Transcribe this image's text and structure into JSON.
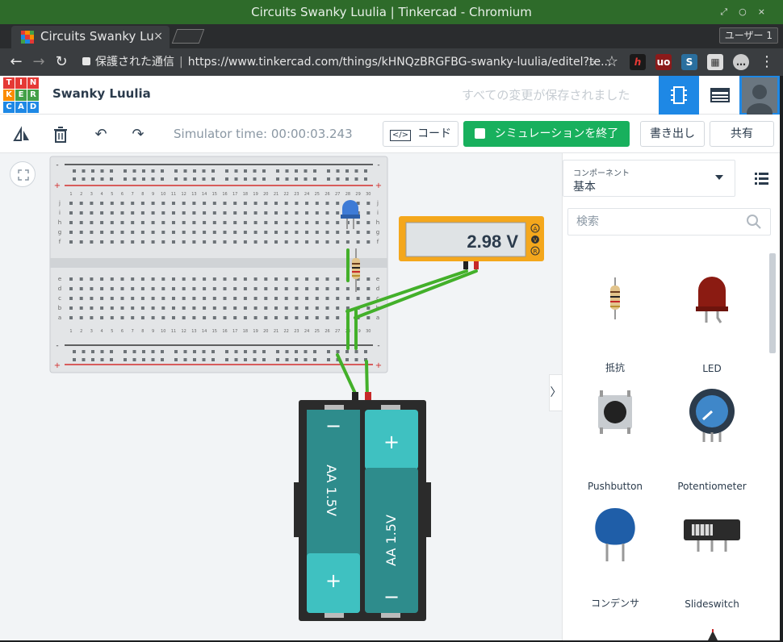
{
  "window": {
    "title": "Circuits Swanky Luulia | Tinkercad - Chromium"
  },
  "browser": {
    "tab_title": "Circuits Swanky Lu",
    "tab_close": "×",
    "user_label": "ユーザー 1",
    "secure_label": "保護された通信",
    "url": "https://www.tinkercad.com/things/kHNQzBRGFBG-swanky-luulia/editel?te...",
    "ext_h": "h",
    "ext_ub_count": "2",
    "ext_s": "S"
  },
  "app": {
    "logo_letters": [
      "T",
      "I",
      "N",
      "K",
      "E",
      "R",
      "C",
      "A",
      "D"
    ],
    "project_name": "Swanky Luulia",
    "save_status": "すべての変更が保存されました",
    "simulator_time_label": "Simulator time: 00:00:03.243",
    "code_button": "コード",
    "stop_sim_button": "シミュレーションを終了",
    "export_button": "書き出し",
    "share_button": "共有"
  },
  "multimeter": {
    "reading": "2.98 V",
    "modes": [
      "A",
      "V",
      "R"
    ]
  },
  "breadboard": {
    "row_letters_top": [
      "j",
      "i",
      "h",
      "g",
      "f"
    ],
    "row_letters_bottom": [
      "e",
      "d",
      "c",
      "b",
      "a"
    ],
    "columns": [
      "1",
      "2",
      "3",
      "4",
      "5",
      "6",
      "7",
      "8",
      "9",
      "10",
      "11",
      "12",
      "13",
      "14",
      "15",
      "16",
      "17",
      "18",
      "19",
      "20",
      "21",
      "22",
      "23",
      "24",
      "25",
      "26",
      "27",
      "28",
      "29",
      "30"
    ],
    "rail_minus": "-",
    "rail_plus": "+"
  },
  "battery": {
    "cell_label": "AA 1.5V",
    "plus": "+",
    "minus": "−"
  },
  "panel": {
    "category_label": "コンポーネント",
    "category_value": "基本",
    "search_placeholder": "検索",
    "components": [
      "抵抗",
      "LED",
      "Pushbutton",
      "Potentiometer",
      "コンデンサ",
      "Slideswitch"
    ]
  },
  "colors": {
    "accent_blue": "#1e88e5",
    "sim_green": "#18b05d",
    "wire_green": "#43b02a",
    "meter_orange": "#f4a71c",
    "battery_teal": "#2e8c8c"
  }
}
